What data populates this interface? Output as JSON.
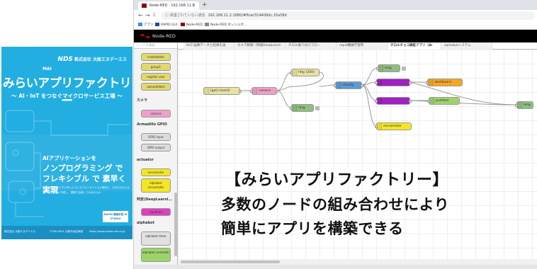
{
  "cover": {
    "brand_logo": "NDS",
    "brand_name": "株式会社 大阪エヌデーエス",
    "mai_tag": "MAI",
    "title": "みらいアプリファクトリー",
    "subtitle": "～ AI・IoT をつなぐマイクロサービス工場 ～",
    "tagline_1": "AIアプリケーションを",
    "tagline_2": "ノンプログラミング で",
    "tagline_3": "フレキシブル で 素早く 実現",
    "description": "AI・IoTをつなぐデジタルトランスフォーメーション時代に、だれもかんたんアプリを素早く作成し、現場で活用してみませんか",
    "badge": "RAPID 機械学習 AI STUDIO",
    "footer_company": "株式会社 大阪エヌデーエス",
    "footer_address": "〒530-0001 大阪市北区梅田",
    "footer_url": "https://www.osaka-nds.co.jp"
  },
  "browser": {
    "tab_title": "Node-RED : 192.168.11.2",
    "tab_close": "×",
    "new_tab": "+",
    "nav_back": "←",
    "nav_forward": "→",
    "nav_reload": "C",
    "url_warning": "ⓘ 保護されていない通信",
    "url": "192.168.11.2:1880/#flow/314408dc.15a58d",
    "bookmarks": [
      "アプリ",
      "RAPID GUI",
      "Node-RED",
      "Node-RED ダッシュボ..."
    ]
  },
  "nodered": {
    "header_title": "Node-RED",
    "palette_search_placeholder": "ノードを検索",
    "palette": {
      "top_nodes": [
        "createfolder",
        "group1",
        "register user",
        "upload(data)"
      ],
      "category_camera": "カメラ",
      "camera_nodes": [
        "camera"
      ],
      "category_gpio": "Armadillo GPIO",
      "gpio_nodes": [
        "GPIO input",
        "GPIO output"
      ],
      "category_actuator": "actuator",
      "actuator_nodes": [
        "servomotor",
        "alphabot servomotor"
      ],
      "category_deeplearning": "判定(DeepLearni...",
      "deeplearning_nodes": [
        "rapidroid"
      ],
      "category_alphabot": "alphabot",
      "alphabot_nodes": [
        "alphabot timer",
        "alphabot controller"
      ]
    },
    "flow_tabs": [
      "RGT-画像データと結果を送",
      "カメラ制御（時報DeepLearni",
      "チロル振り分けフロー",
      "rapid機械学習用",
      "チロルチョコ検証アプリ（Ai",
      "alphabotシステム"
    ],
    "active_tab_index": 4,
    "flow_nodes": {
      "inject": "[get] rtsert2",
      "http": "http (200)",
      "camera": "camera",
      "classify": "classify",
      "msg1": "msg",
      "msg2": "msg",
      "switch1": "",
      "switch2": "",
      "dashboard": "dashboard",
      "pushbot": "pushbot",
      "servomotor": "servomotor",
      "msg3": "msg"
    }
  },
  "overlay": {
    "line1": "【みらいアプリファクトリー】",
    "line2": "多数のノードの組み合わせにより",
    "line3": "簡単にアプリを構築できる"
  }
}
